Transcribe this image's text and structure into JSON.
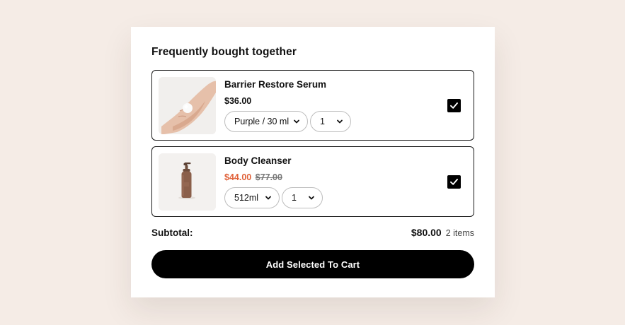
{
  "widget": {
    "title": "Frequently bought together"
  },
  "items": [
    {
      "name": "Barrier Restore Serum",
      "price": "$36.00",
      "compare_price": "",
      "variant": "Purple / 30 ml",
      "quantity": "1",
      "selected": true,
      "image_icon": "hand-with-cream-image"
    },
    {
      "name": "Body Cleanser",
      "price": "$44.00",
      "compare_price": "$77.00",
      "variant": "512ml",
      "quantity": "1",
      "selected": true,
      "image_icon": "pump-bottle-image"
    }
  ],
  "summary": {
    "subtotal_label": "Subtotal:",
    "subtotal_value": "$80.00",
    "item_count": "2 items"
  },
  "cta": {
    "label": "Add Selected To Cart"
  },
  "colors": {
    "background": "#f5ece6",
    "sale_price": "#e0623a",
    "button": "#000000"
  }
}
